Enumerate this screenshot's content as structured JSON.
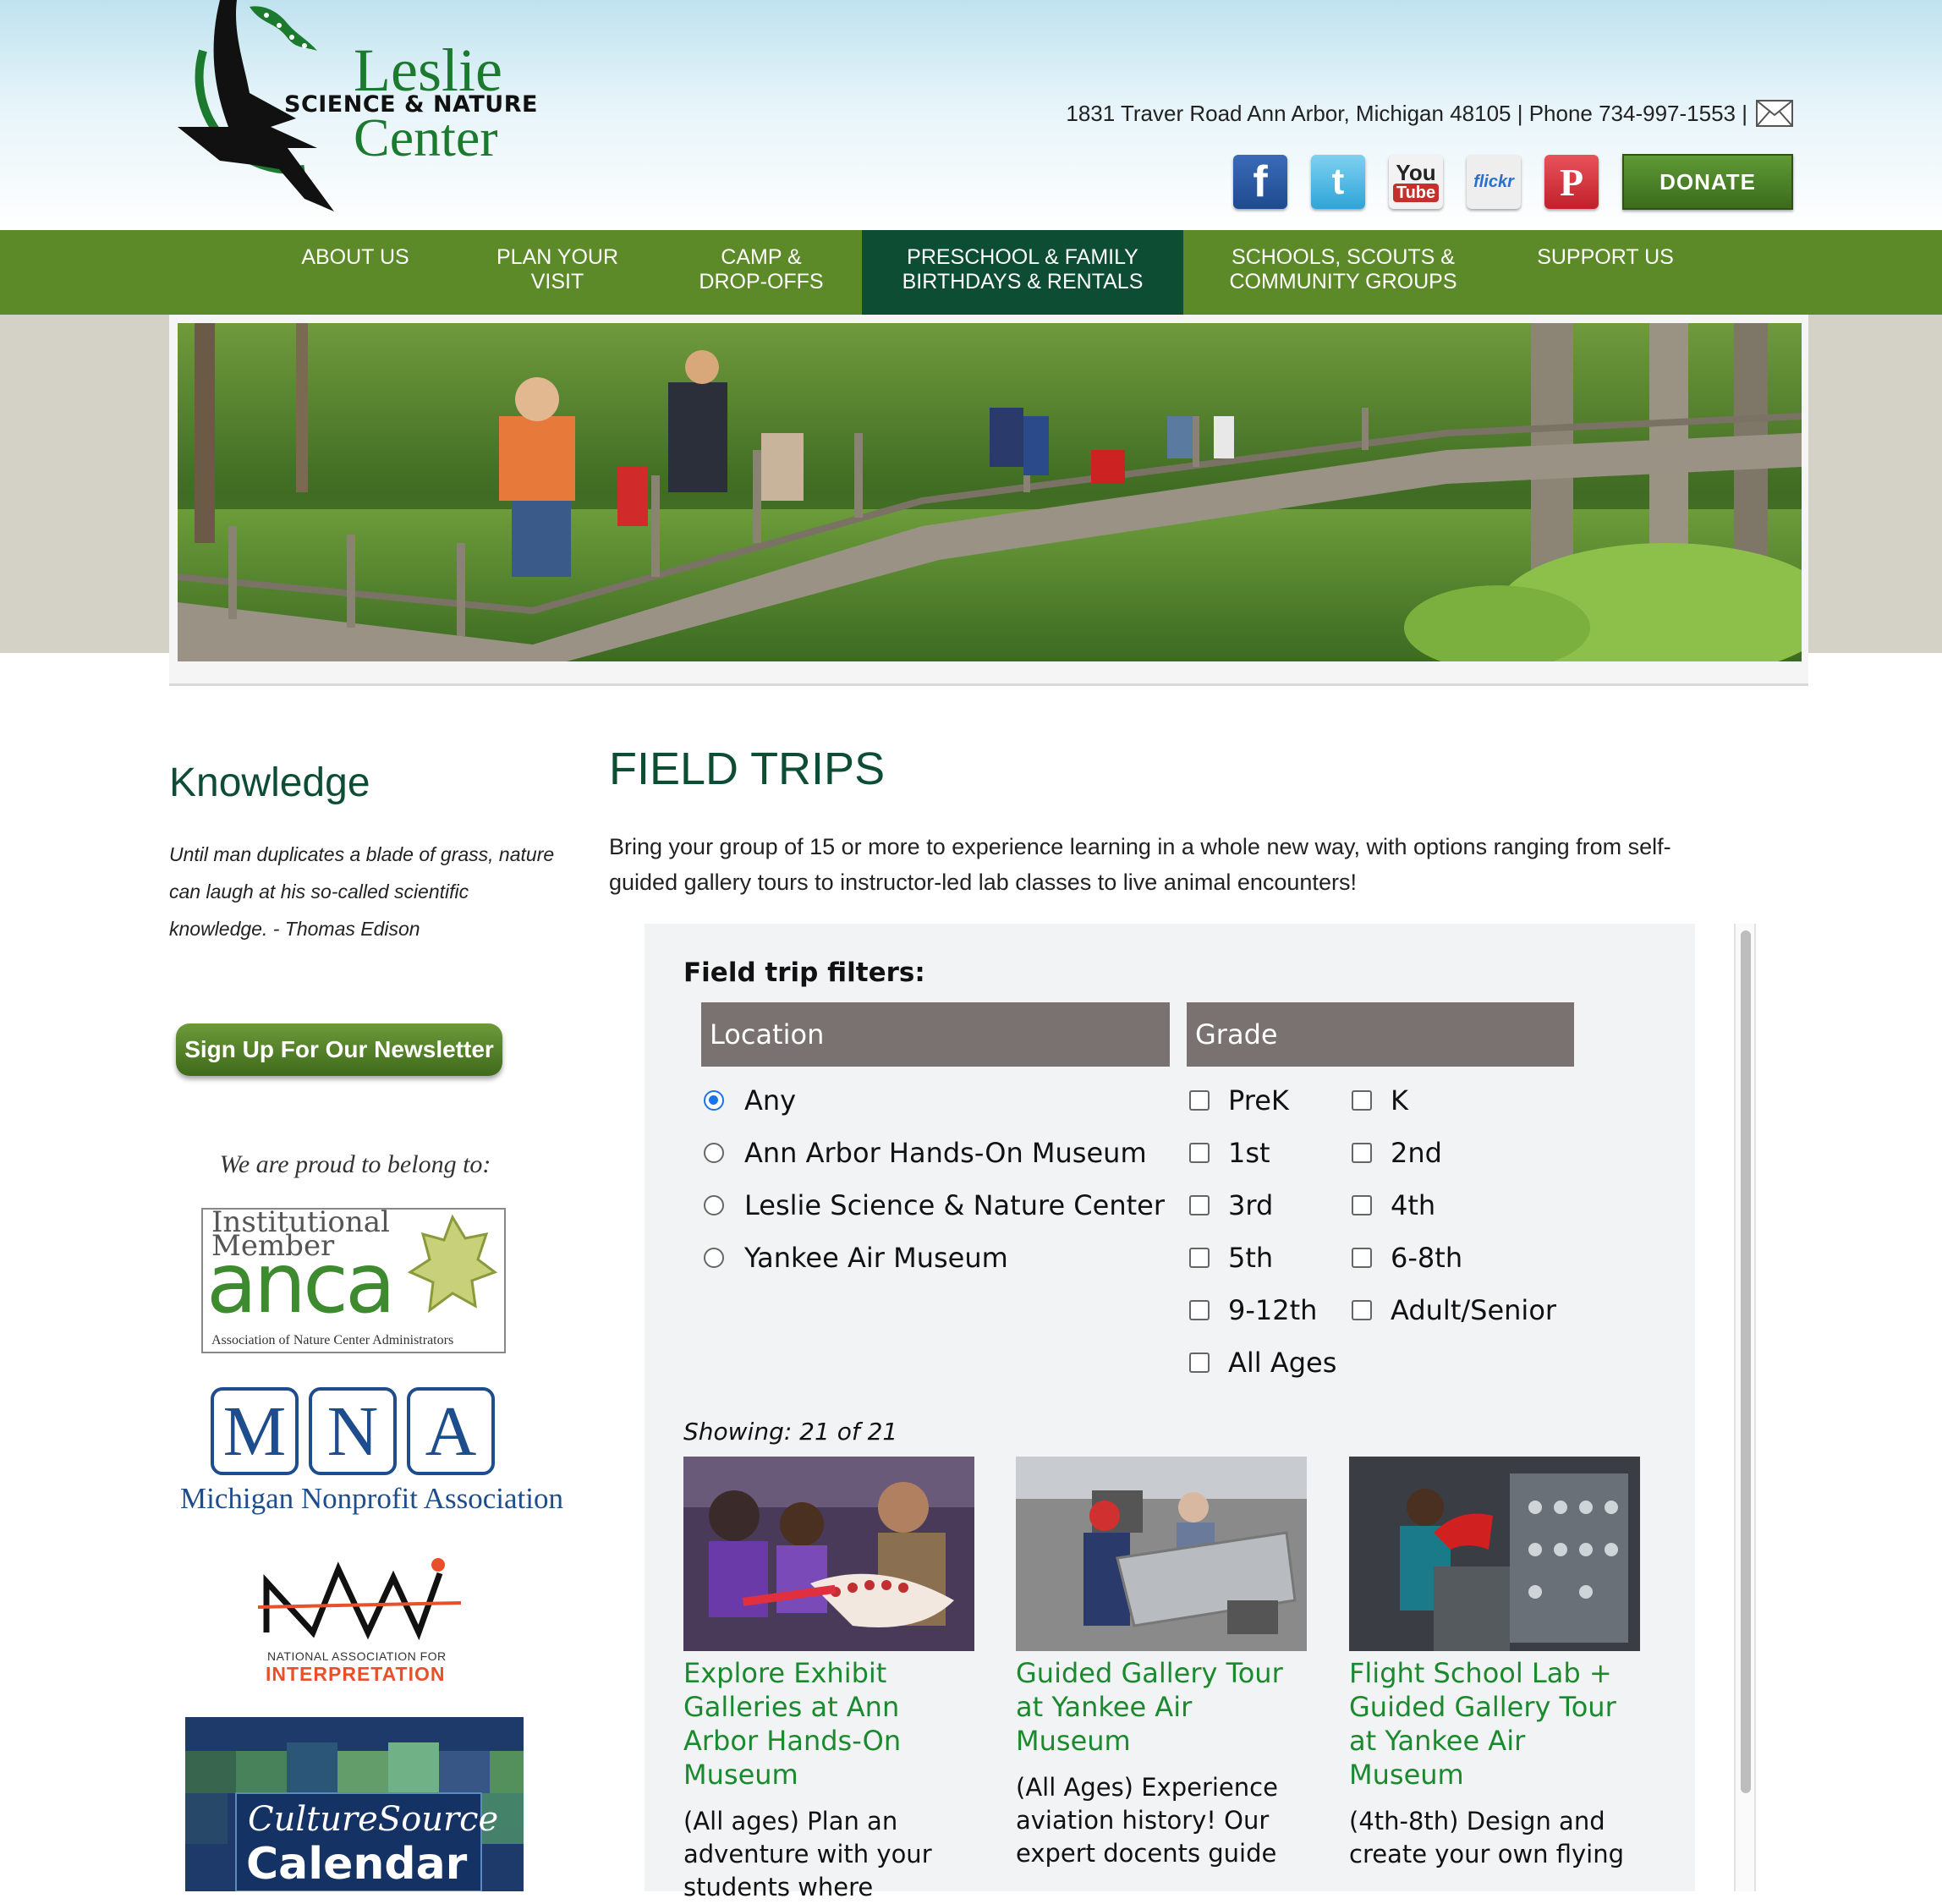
{
  "header": {
    "logo": {
      "name": "Leslie",
      "sub": "SCIENCE & NATURE",
      "center": "Center"
    },
    "contact": "1831 Traver Road Ann Arbor, Michigan 48105 | Phone 734-997-1553 |",
    "social": {
      "facebook": "f",
      "twitter": "t",
      "youtube_you": "You",
      "youtube_tube": "Tube",
      "flickr": "flickr",
      "pinterest": "P"
    },
    "donate_label": "DONATE"
  },
  "nav": {
    "items": [
      {
        "label": "ABOUT US"
      },
      {
        "label": "PLAN YOUR VISIT"
      },
      {
        "label": "CAMP & DROP-OFFS"
      },
      {
        "label": "PRESCHOOL & FAMILY BIRTHDAYS & RENTALS"
      },
      {
        "label": "SCHOOLS, SCOUTS & COMMUNITY GROUPS"
      },
      {
        "label": "SUPPORT US"
      }
    ],
    "active_color": "#0d4d34",
    "bar_color": "#5c8a28"
  },
  "sidebar": {
    "title": "Knowledge",
    "quote": "Until man duplicates a blade of grass, nature can laugh at his so-called scientific knowledge. - Thomas Edison",
    "newsletter_label": "Sign Up For Our Newsletter",
    "proud": "We are proud to belong to:",
    "anca": {
      "line1": "Institutional",
      "line2": "Member",
      "word": "anca",
      "full": "Association of Nature Center Administrators"
    },
    "mna": {
      "letters": [
        "M",
        "N",
        "A"
      ],
      "name": "Michigan Nonprofit Association"
    },
    "nai": {
      "line1": "NATIONAL ASSOCIATION FOR",
      "line2": "INTERPRETATION"
    },
    "culture_source": {
      "line1": "CultureSource",
      "line2": "Calendar"
    }
  },
  "main": {
    "title": "FIELD TRIPS",
    "intro": "Bring your group of 15 or more to experience learning in a whole new way, with options ranging from self-guided gallery tours to instructor-led lab classes to live animal encounters!",
    "filters_title": "Field trip filters:",
    "location_header": "Location",
    "grade_header": "Grade",
    "locations": [
      {
        "label": "Any",
        "selected": true
      },
      {
        "label": "Ann Arbor Hands-On Museum",
        "selected": false
      },
      {
        "label": "Leslie Science & Nature Center",
        "selected": false
      },
      {
        "label": "Yankee Air Museum",
        "selected": false
      }
    ],
    "grades": [
      "PreK",
      "K",
      "1st",
      "2nd",
      "3rd",
      "4th",
      "5th",
      "6-8th",
      "9-12th",
      "Adult/Senior",
      "All Ages"
    ],
    "showing": "Showing: 21 of 21",
    "cards": [
      {
        "title": "Explore Exhibit Galleries at Ann Arbor Hands-On Museum",
        "desc": "(All ages) Plan an adventure with your students where"
      },
      {
        "title": "Guided Gallery Tour at Yankee Air Museum",
        "desc": "(All Ages) Experience aviation history! Our expert docents guide"
      },
      {
        "title": "Flight School Lab + Guided Gallery Tour at Yankee Air Museum",
        "desc": "(4th-8th) Design and create your own flying"
      }
    ]
  }
}
